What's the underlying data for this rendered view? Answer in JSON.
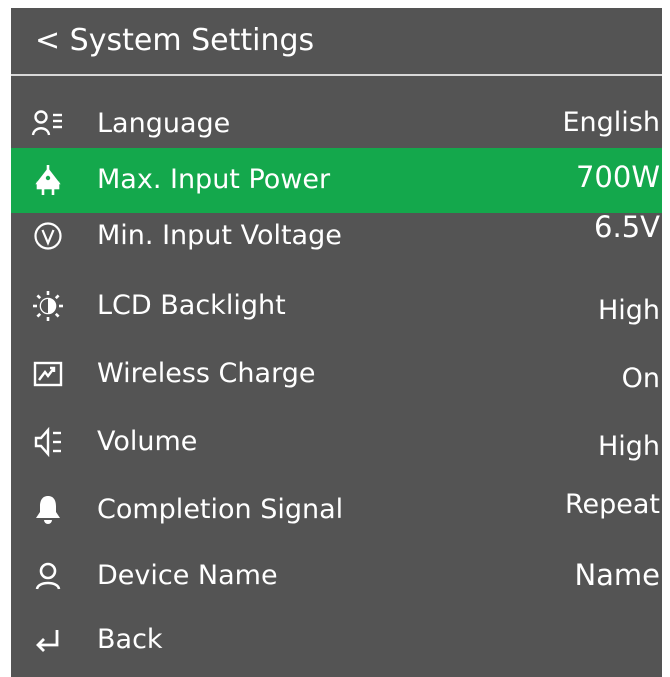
{
  "header": {
    "title": "< System Settings"
  },
  "colors": {
    "background": "#545454",
    "selected": "#14a84c",
    "text": "#ffffff",
    "divider": "#d9d9d9"
  },
  "menu": {
    "items": [
      {
        "label": "Language",
        "value": "English",
        "icon": "language-icon"
      },
      {
        "label": "Max. Input Power",
        "value": "700W",
        "icon": "plug-icon",
        "selected": true
      },
      {
        "label": "Min. Input Voltage",
        "value": "6.5V",
        "icon": "voltage-icon"
      },
      {
        "label": "LCD Backlight",
        "value": "High",
        "icon": "brightness-icon"
      },
      {
        "label": "Wireless Charge",
        "value": "On",
        "icon": "wireless-charge-icon"
      },
      {
        "label": "Volume",
        "value": "High",
        "icon": "speaker-icon"
      },
      {
        "label": "Completion Signal",
        "value": "Repeat",
        "icon": "bell-icon"
      },
      {
        "label": "Device Name",
        "value": "Name",
        "icon": "user-icon"
      },
      {
        "label": "Back",
        "value": "",
        "icon": "return-icon"
      }
    ]
  }
}
